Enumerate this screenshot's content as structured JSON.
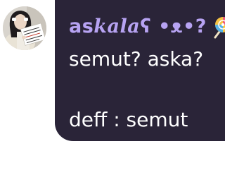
{
  "message": {
    "sender": {
      "name_prefix": "as",
      "name_stylized": "kala",
      "name_suffix": "ʕ •ᴥ•?",
      "emoji_icon": "lollipop-icon",
      "color": "#b7a3f2"
    },
    "lines": [
      "semut? aska?",
      "deff : semut"
    ],
    "bubble_color": "#2a2438",
    "text_color": "#ffffff"
  }
}
